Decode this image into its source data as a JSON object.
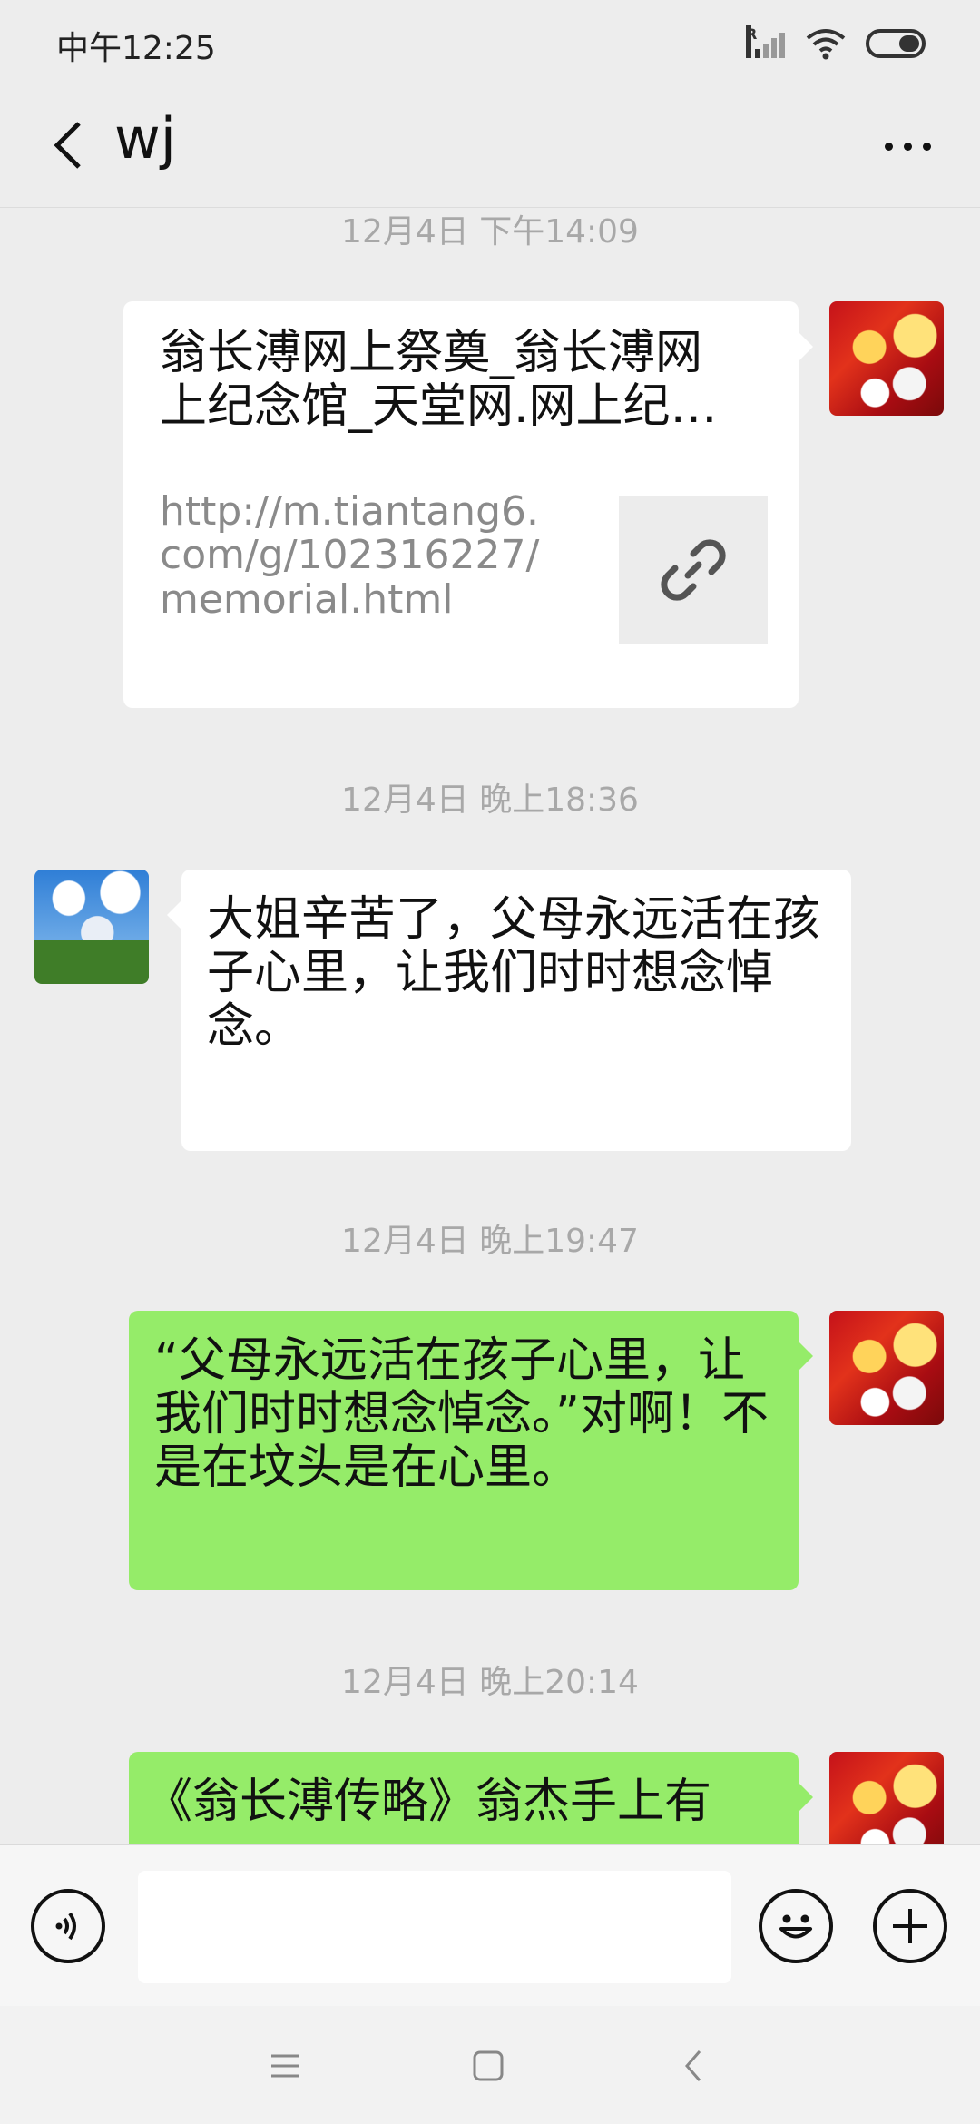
{
  "status_bar": {
    "time": "中午12:25",
    "signal_badge": "R"
  },
  "header": {
    "title": "wj"
  },
  "messages": {
    "ts1": "12月4日 下午14:09",
    "link_card": {
      "title": "翁长溥网上祭奠_翁长溥网上纪念馆_天堂网.网上纪念馆",
      "url": "http://m.tiantang6.com/g/102316227/memorial.html"
    },
    "ts2": "12月4日 晚上18:36",
    "msg2": "大姐辛苦了，父母永远活在孩子心里，让我们时时想念悼念。",
    "ts3": "12月4日 晚上19:47",
    "msg3": "“父母永远活在孩子心里，让我们时时想念悼念。”对啊！不是在坟头是在心里。",
    "ts4": "12月4日 晚上20:14",
    "msg4": "《翁长溥传略》翁杰手上有"
  },
  "colors": {
    "sent_bubble": "#95ec69",
    "received_bubble": "#ffffff",
    "background": "#ededed"
  },
  "icons": [
    "back-icon",
    "more-icon",
    "link-icon",
    "voice-icon",
    "emoji-icon",
    "plus-icon",
    "menu-icon",
    "home-icon",
    "nav-back-icon"
  ]
}
